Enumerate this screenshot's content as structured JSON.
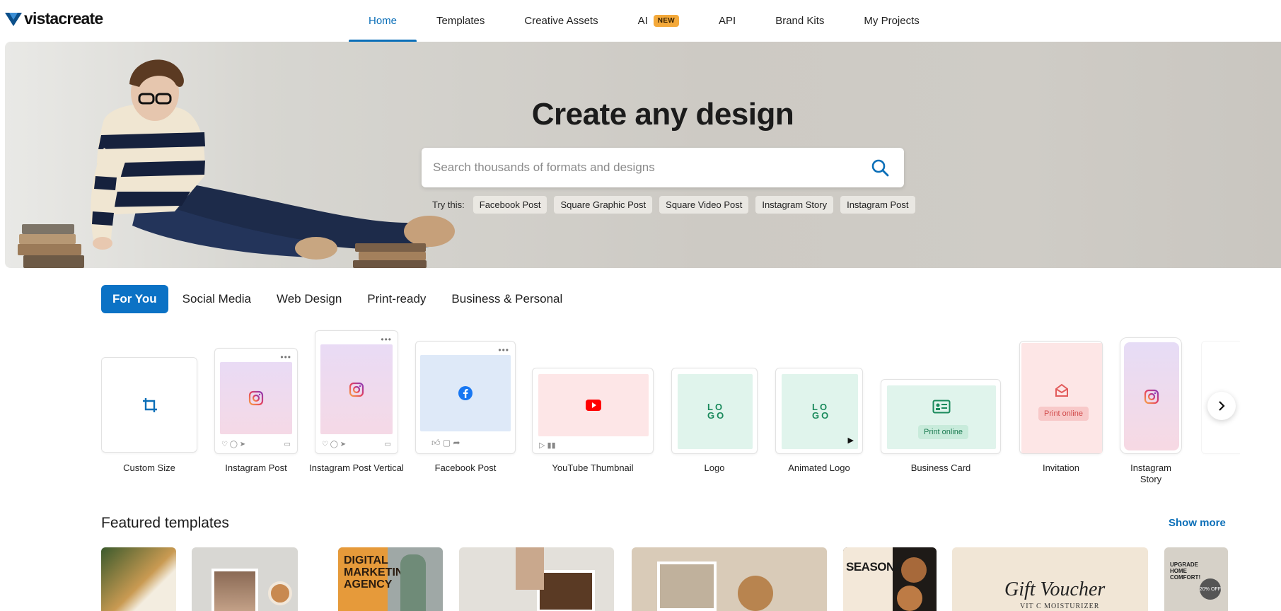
{
  "brand": {
    "name": "vistacreate",
    "accent": "#0b6fb8"
  },
  "nav": {
    "items": [
      {
        "label": "Home",
        "active": true
      },
      {
        "label": "Templates"
      },
      {
        "label": "Creative Assets"
      },
      {
        "label": "AI",
        "badge": "NEW"
      },
      {
        "label": "API"
      },
      {
        "label": "Brand Kits"
      },
      {
        "label": "My Projects"
      }
    ]
  },
  "hero": {
    "title": "Create any design",
    "search_placeholder": "Search thousands of formats and designs",
    "try_label": "Try this:",
    "suggestions": [
      "Facebook Post",
      "Square Graphic Post",
      "Square Video Post",
      "Instagram Story",
      "Instagram Post"
    ]
  },
  "categories": {
    "tabs": [
      "For You",
      "Social Media",
      "Web Design",
      "Print-ready",
      "Business & Personal"
    ],
    "active": "For You"
  },
  "formats": [
    {
      "label": "Custom Size",
      "icon": "crop-icon"
    },
    {
      "label": "Instagram Post",
      "icon": "instagram-icon"
    },
    {
      "label": "Instagram Post Vertical",
      "icon": "instagram-icon"
    },
    {
      "label": "Facebook Post",
      "icon": "facebook-icon"
    },
    {
      "label": "YouTube Thumbnail",
      "icon": "youtube-icon"
    },
    {
      "label": "Logo",
      "icon": "logo-icon"
    },
    {
      "label": "Animated Logo",
      "icon": "logo-icon"
    },
    {
      "label": "Business Card",
      "icon": "id-card-icon",
      "pill": "Print online"
    },
    {
      "label": "Invitation",
      "icon": "envelope-icon",
      "pill": "Print online"
    },
    {
      "label": "Instagram Story",
      "icon": "instagram-icon"
    }
  ],
  "logo_glyph": "LO GO",
  "featured": {
    "title": "Featured templates",
    "show_more": "Show more",
    "template_texts": {
      "digital": "DIGITAL MARKETING AGENCY",
      "seasonal": "SEASONAL",
      "gift": "Gift Voucher",
      "gift_sub": "VIT C MOISTURIZER",
      "upgrade": "UPGRADE HOME COMFORT!",
      "offer": "20% OFF"
    }
  }
}
